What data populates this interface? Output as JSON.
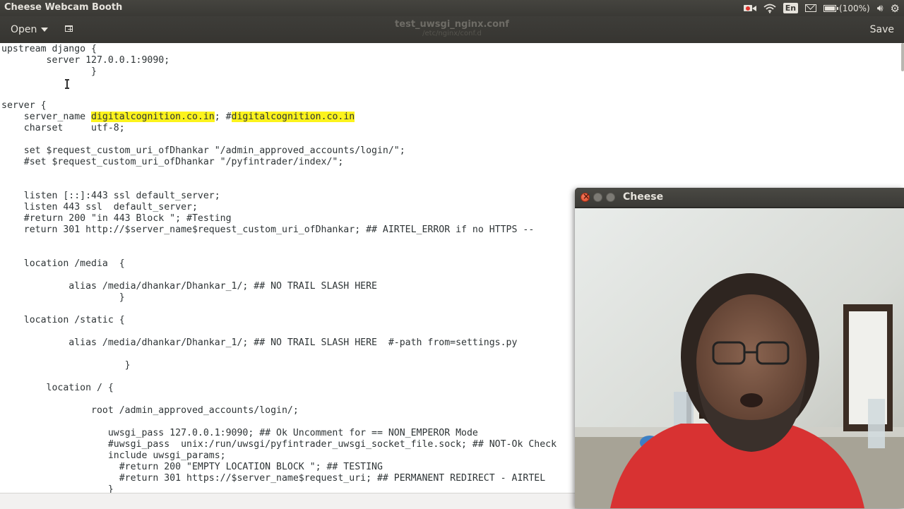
{
  "panel": {
    "app_title": "Cheese Webcam Booth",
    "keyboard": "En",
    "battery": "(100%)"
  },
  "gedit": {
    "open_label": "Open",
    "doc_title": "test_uwsgi_nginx.conf",
    "doc_path": "/etc/nginx/conf.d",
    "save_label": "Save"
  },
  "editor": {
    "lines": [
      [
        "upstream django {"
      ],
      [
        "        server 127.0.0.1:9090;"
      ],
      [
        "                }"
      ],
      [
        ""
      ],
      [
        ""
      ],
      [
        "server {"
      ],
      [
        "    server_name ",
        {
          "hl": "digitalcognition.co.in"
        },
        "; #",
        {
          "hl": "digitalcognition.co.in"
        }
      ],
      [
        "    charset     utf-8;"
      ],
      [
        ""
      ],
      [
        "    set $request_custom_uri_ofDhankar \"/admin_approved_accounts/login/\";"
      ],
      [
        "    #set $request_custom_uri_ofDhankar \"/pyfintrader/index/\";"
      ],
      [
        ""
      ],
      [
        ""
      ],
      [
        "    listen [::]:443 ssl default_server;"
      ],
      [
        "    listen 443 ssl  default_server;"
      ],
      [
        "    #return 200 \"in 443 Block \"; #Testing"
      ],
      [
        "    return 301 http://$server_name$request_custom_uri_ofDhankar; ## AIRTEL_ERROR if no HTTPS --"
      ],
      [
        ""
      ],
      [
        ""
      ],
      [
        "    location /media  {"
      ],
      [
        ""
      ],
      [
        "            alias /media/dhankar/Dhankar_1/; ## NO TRAIL SLASH HERE"
      ],
      [
        "                     }"
      ],
      [
        ""
      ],
      [
        "    location /static {"
      ],
      [
        ""
      ],
      [
        "            alias /media/dhankar/Dhankar_1/; ## NO TRAIL SLASH HERE  #-path from=settings.py"
      ],
      [
        ""
      ],
      [
        "                      }"
      ],
      [
        ""
      ],
      [
        "        location / {"
      ],
      [
        ""
      ],
      [
        "                root /admin_approved_accounts/login/;"
      ],
      [
        ""
      ],
      [
        "                   uwsgi_pass 127.0.0.1:9090; ## Ok Uncomment for == NON_EMPEROR Mode"
      ],
      [
        "                   #uwsgi_pass  unix:/run/uwsgi/pyfintrader_uwsgi_socket_file.sock; ## NOT-Ok Check"
      ],
      [
        "                   include uwsgi_params;"
      ],
      [
        "                     #return 200 \"EMPTY LOCATION BLOCK \"; ## TESTING"
      ],
      [
        "                     #return 301 https://$server_name$request_uri; ## PERMANENT REDIRECT - AIRTEL"
      ],
      [
        "                   }"
      ]
    ]
  },
  "cheese": {
    "title": "Cheese"
  },
  "colors": {
    "highlight": "#fcf31c",
    "panel_bg": "#3a3935",
    "close_button": "#df4b2a"
  },
  "icons": [
    "record-camera-icon",
    "wifi-icon",
    "mail-icon",
    "battery-icon",
    "volume-icon",
    "settings-gear-icon",
    "new-tab-icon",
    "dropdown-chevron-icon",
    "text-cursor-icon"
  ]
}
